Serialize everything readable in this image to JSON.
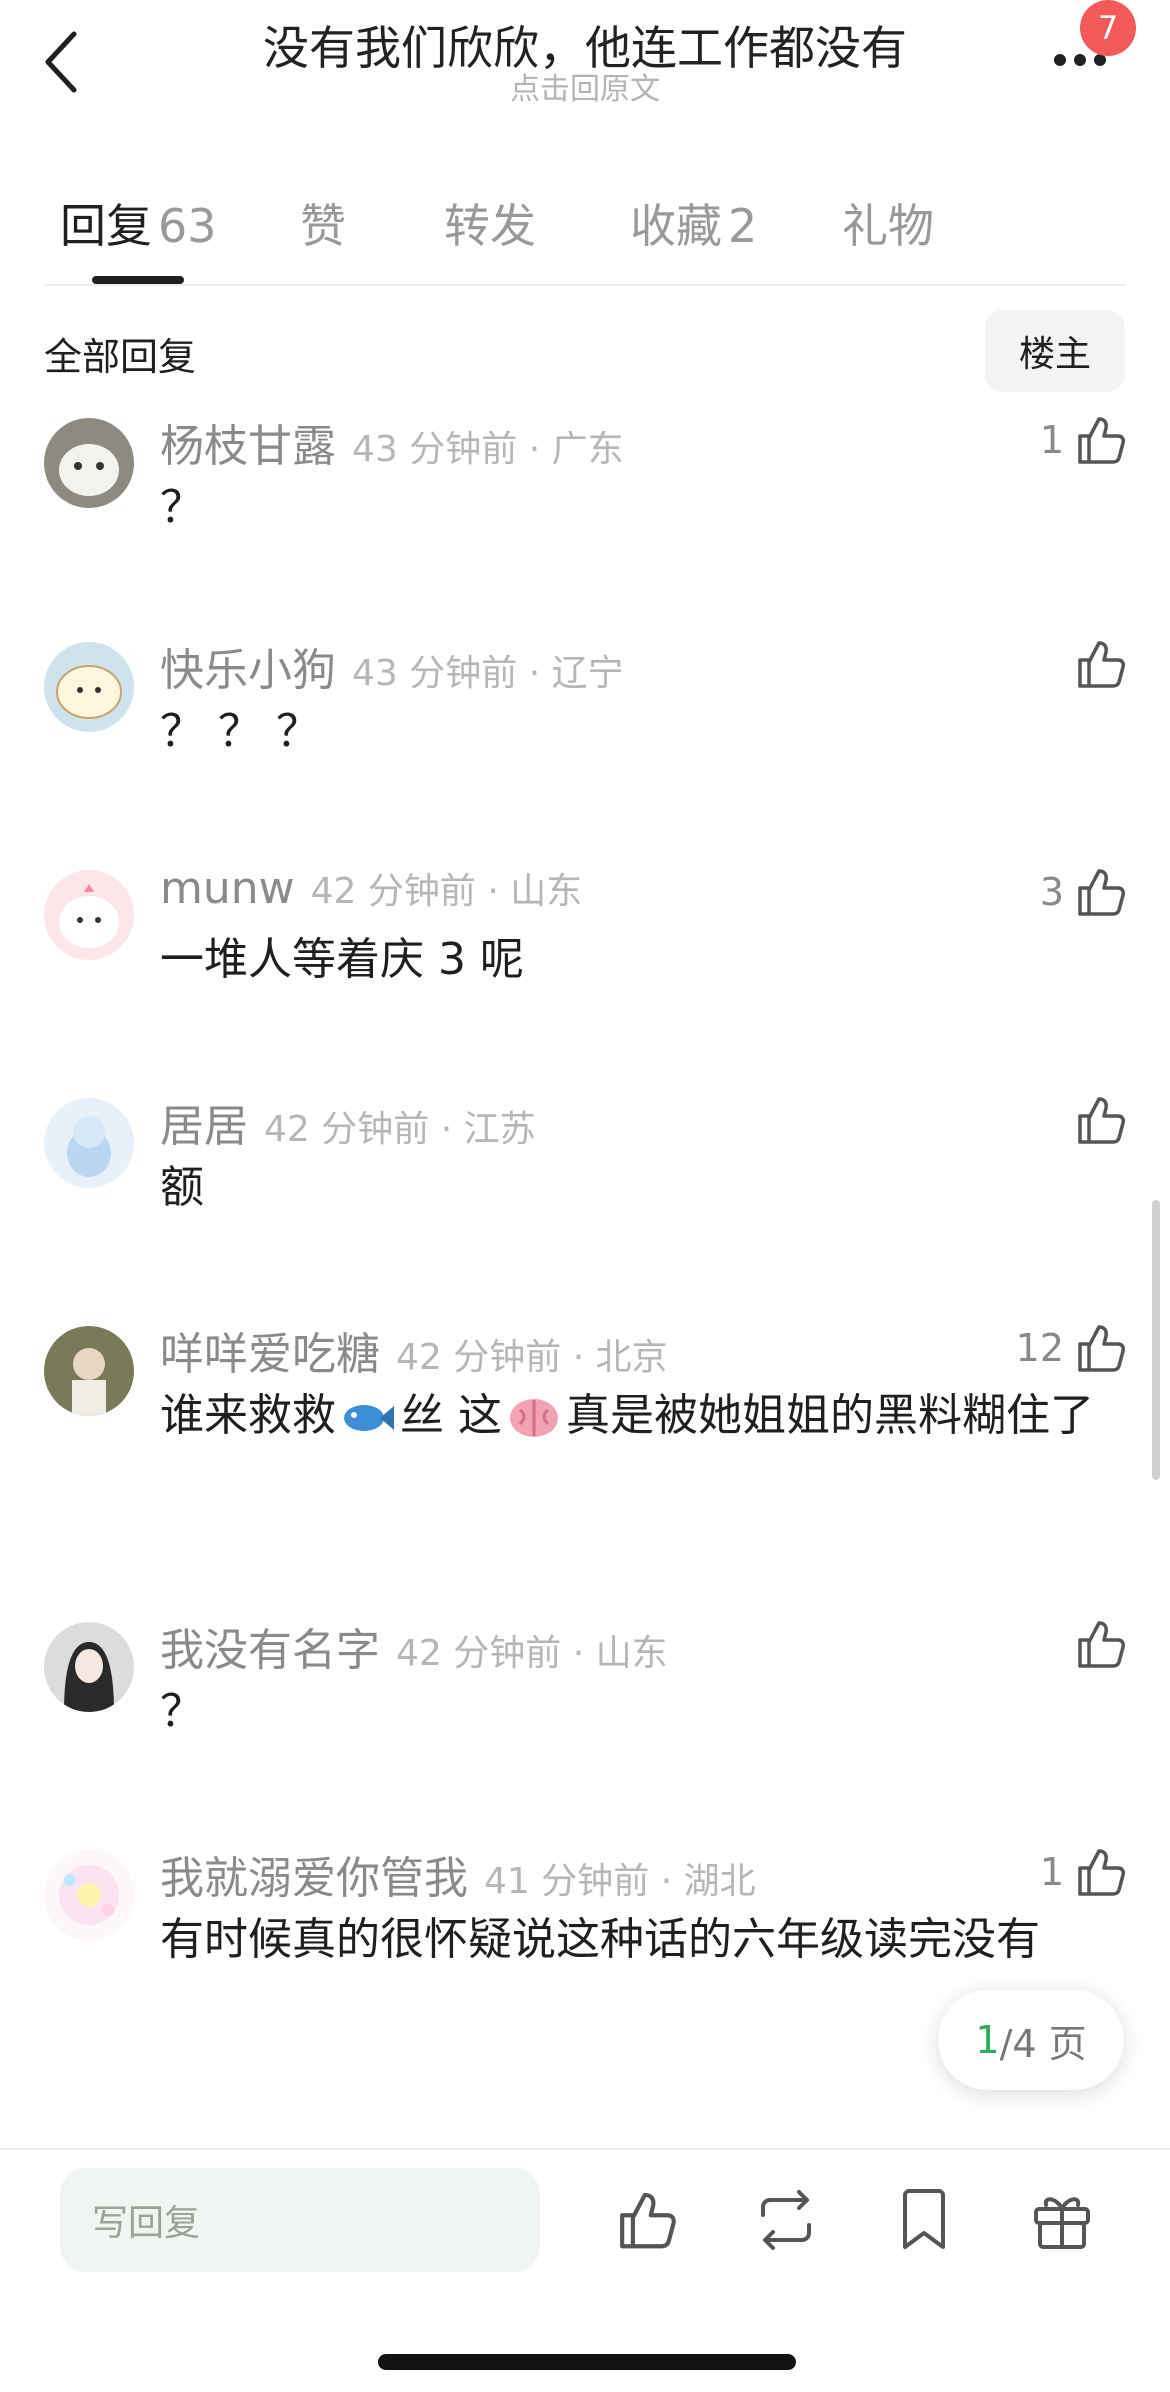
{
  "header": {
    "title": "没有我们欣欣，他连工作都没有",
    "subtitle": "点击回原文",
    "notification_count": "7"
  },
  "tabs": [
    {
      "label": "回复",
      "count": "63",
      "active": true
    },
    {
      "label": "赞",
      "count": ""
    },
    {
      "label": "转发",
      "count": ""
    },
    {
      "label": "收藏",
      "count": "2"
    },
    {
      "label": "礼物",
      "count": ""
    }
  ],
  "filter": {
    "all_label": "全部回复",
    "owner_label": "楼主"
  },
  "comments": [
    {
      "name": "杨枝甘露",
      "time": "43 分钟前 · 广东",
      "likes": "1",
      "text": "？"
    },
    {
      "name": "快乐小狗",
      "time": "43 分钟前 · 辽宁",
      "likes": "",
      "text": "？ ？ ？"
    },
    {
      "name": "munw",
      "time": "42 分钟前 · 山东",
      "likes": "3",
      "text": "一堆人等着庆 3 呢"
    },
    {
      "name": "居居",
      "time": "42 分钟前 · 江苏",
      "likes": "",
      "text": "额"
    },
    {
      "name": "咩咩爱吃糖",
      "time": "42 分钟前 · 北京",
      "likes": "12",
      "text_part1": "谁来救救",
      "text_part2": "丝 这",
      "text_part3": "真是被她姐姐的黑料糊住了",
      "emoji1": "fish-emoji",
      "emoji2": "brain-emoji"
    },
    {
      "name": "我没有名字",
      "time": "42 分钟前 · 山东",
      "likes": "",
      "text": "？"
    },
    {
      "name": "我就溺爱你管我",
      "time": "41 分钟前 · 湖北",
      "likes": "1",
      "text": "有时候真的很怀疑说这种话的六年级读完没有"
    }
  ],
  "pager": {
    "current": "1",
    "total": "/4 页"
  },
  "bottom_bar": {
    "reply_placeholder": "写回复",
    "icons": [
      "thumb-up-icon",
      "repost-icon",
      "bookmark-icon",
      "gift-icon"
    ]
  },
  "colors": {
    "accent_green": "#2eaa5a",
    "badge_red": "#f25a5a",
    "input_bg": "#f1f5f1"
  }
}
